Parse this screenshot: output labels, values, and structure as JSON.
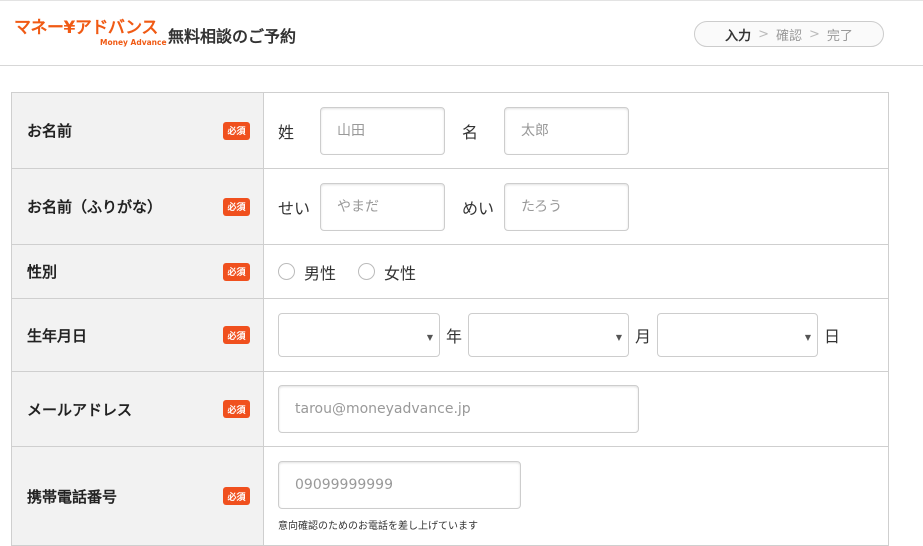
{
  "header": {
    "logo_text": "マネー¥アドバンス",
    "logo_sub": "Money Advance",
    "title": "無料相談のご予約",
    "steps": [
      "入力",
      "確認",
      "完了"
    ],
    "step_separator": ">",
    "accent_color": "#f05a14"
  },
  "required_label": "必須",
  "form": {
    "name": {
      "label": "お名前",
      "last_label": "姓",
      "last_placeholder": "山田",
      "first_label": "名",
      "first_placeholder": "太郎"
    },
    "kana": {
      "label": "お名前（ふりがな）",
      "last_label": "せい",
      "last_placeholder": "やまだ",
      "first_label": "めい",
      "first_placeholder": "たろう"
    },
    "gender": {
      "label": "性別",
      "options": [
        "男性",
        "女性"
      ]
    },
    "birth": {
      "label": "生年月日",
      "year_label": "年",
      "month_label": "月",
      "day_label": "日",
      "arrow": "▼"
    },
    "email": {
      "label": "メールアドレス",
      "placeholder": "tarou@moneyadvance.jp"
    },
    "phone": {
      "label": "携帯電話番号",
      "placeholder": "09099999999",
      "note": "意向確認のためのお電話を差し上げています"
    }
  }
}
